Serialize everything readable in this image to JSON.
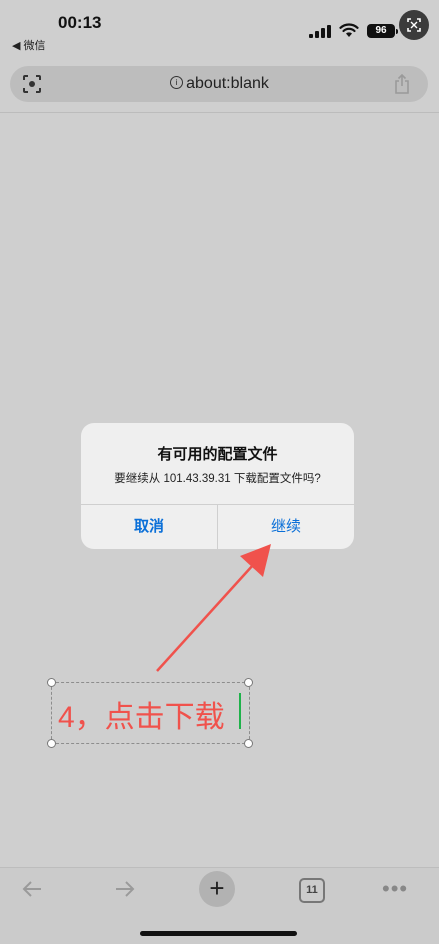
{
  "status_bar": {
    "time": "00:13",
    "back_app": "◀ 微信",
    "battery": "96"
  },
  "browser": {
    "url": "about:blank"
  },
  "dialog": {
    "title": "有可用的配置文件",
    "message": "要继续从 101.43.39.31 下载配置文件吗?",
    "cancel_label": "取消",
    "continue_label": "继续"
  },
  "annotation": {
    "text": "4，点击下载",
    "color": "#f0524c"
  },
  "toolbar": {
    "tab_count": "11"
  },
  "colors": {
    "background": "#cfcfcf",
    "dialog_button": "#0a6fd8",
    "accent_red": "#f0524c"
  }
}
